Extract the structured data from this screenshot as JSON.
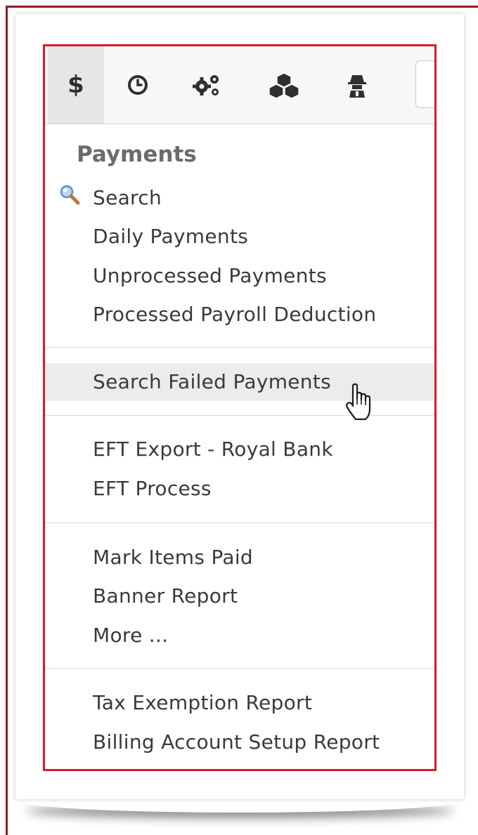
{
  "toolbar": {
    "tools": [
      {
        "icon": "dollar-icon",
        "glyph": "$",
        "active": true
      },
      {
        "icon": "clock-icon"
      },
      {
        "icon": "gears-icon"
      },
      {
        "icon": "cubes-icon"
      },
      {
        "icon": "spy-icon"
      }
    ]
  },
  "menu": {
    "title": "Payments",
    "groups": [
      [
        "Search",
        "Daily Payments",
        "Unprocessed Payments",
        "Processed Payroll Deduction"
      ],
      [
        "Search Failed Payments"
      ],
      [
        "EFT Export - Royal Bank",
        "EFT Process"
      ],
      [
        "Mark Items Paid",
        "Banner Report",
        "More ..."
      ],
      [
        "Tax Exemption Report",
        "Billing Account Setup Report"
      ]
    ],
    "hovered_item": "Search Failed Payments"
  },
  "colors": {
    "highlight_border": "#d0202a",
    "outer_frame": "#8f1d1d",
    "title_text": "#6b6b6b",
    "item_text": "#3a3a3a"
  }
}
